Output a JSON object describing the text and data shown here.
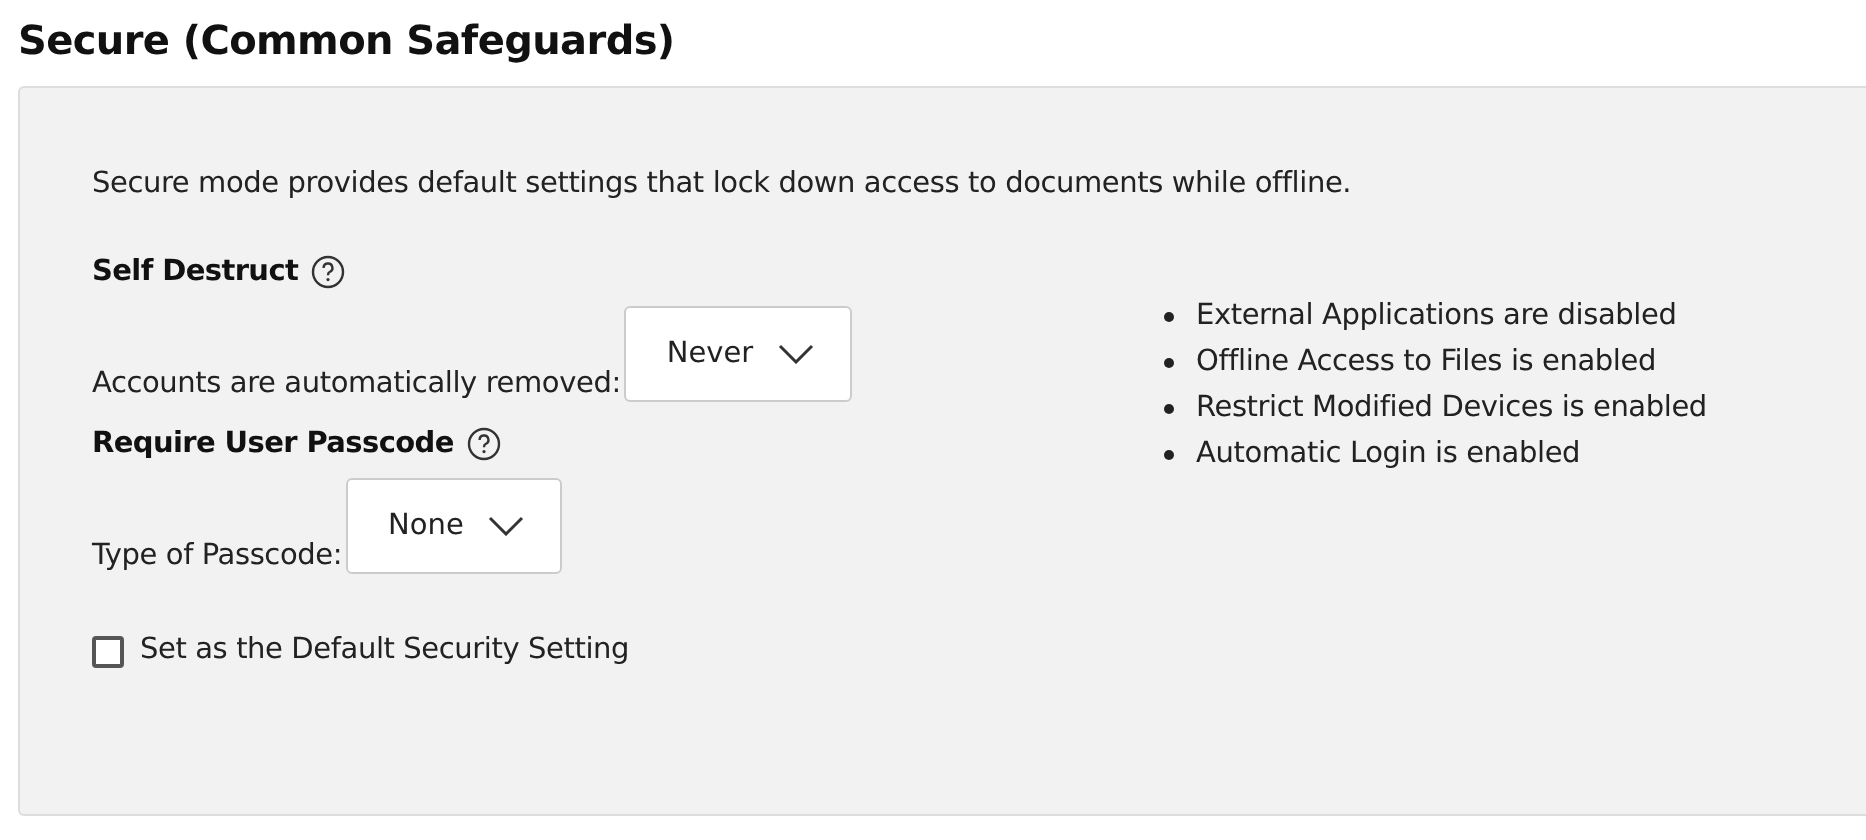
{
  "title": "Secure (Common Safeguards)",
  "description": "Secure mode provides default settings that lock down access to documents while offline.",
  "sections": [
    {
      "heading": "Self Destruct",
      "label": "Accounts are automatically removed:",
      "dropdown": "Never"
    },
    {
      "heading": "Require User Passcode",
      "label": "Type of Passcode:",
      "dropdown": "None"
    }
  ],
  "default_setting": {
    "label": "Set as the Default Security Setting",
    "checked": false
  },
  "features": [
    "External Applications are disabled",
    "Offline Access to Files is enabled",
    "Restrict Modified Devices is enabled",
    "Automatic Login is enabled"
  ]
}
